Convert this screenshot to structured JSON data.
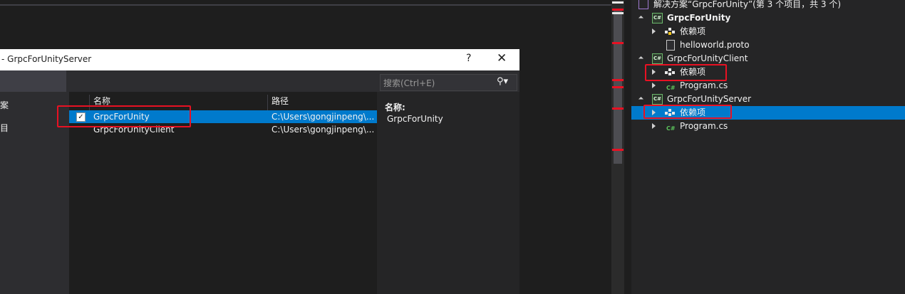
{
  "dialog": {
    "title": "- GrpcForUnityServer",
    "help_label": "?",
    "close_label": "✕",
    "nav_items": [
      {
        "label": "案"
      },
      {
        "label": "目"
      }
    ],
    "search": {
      "placeholder": "搜索(Ctrl+E)",
      "icon": "search-icon"
    },
    "columns": {
      "name": "名称",
      "path": "路径"
    },
    "rows": [
      {
        "checked": true,
        "name": "GrpcForUnity",
        "path": "C:\\Users\\gongjinpeng\\..."
      },
      {
        "checked": false,
        "name": "GrpcForUnityClient",
        "path": "C:\\Users\\gongjinpeng\\..."
      }
    ],
    "detail": {
      "label": "名称:",
      "value": "GrpcForUnity"
    }
  },
  "solution_explorer": {
    "solution_label": "解决方案“GrpcForUnity”(第 3 个项目，共 3 个)",
    "projects": [
      {
        "name": "GrpcForUnity",
        "items": [
          "依赖项",
          "helloworld.proto"
        ]
      },
      {
        "name": "GrpcForUnityClient",
        "items": [
          "依赖项",
          "Program.cs"
        ]
      },
      {
        "name": "GrpcForUnityServer",
        "items": [
          "依赖项",
          "Program.cs"
        ]
      }
    ]
  },
  "colors": {
    "accent": "#007acc",
    "highlight_box": "#e81123",
    "background": "#1e1e1e"
  }
}
